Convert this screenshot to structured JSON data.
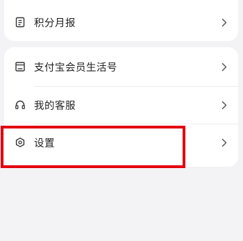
{
  "top_card": {
    "items": [
      {
        "label": "积分月报",
        "icon": "report-doc-icon"
      }
    ]
  },
  "main_card": {
    "items": [
      {
        "label": "支付宝会员生活号",
        "icon": "calendar-card-icon"
      },
      {
        "label": "我的客服",
        "icon": "headset-icon"
      },
      {
        "label": "设置",
        "icon": "settings-hexagon-icon"
      }
    ]
  },
  "highlight": {
    "target": "设置",
    "color": "#e3000f"
  },
  "colors": {
    "background": "#f3f3f5",
    "card": "#ffffff",
    "text": "#222222",
    "icon": "#333333",
    "chevron": "#555555"
  }
}
